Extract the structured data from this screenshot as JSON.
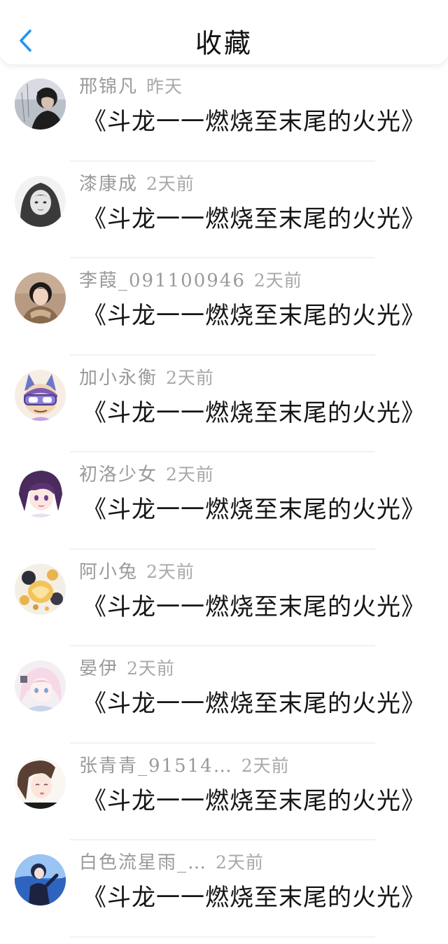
{
  "header": {
    "title": "收藏",
    "accent": "#2196f3"
  },
  "items": [
    {
      "name": "邢锦凡",
      "time": "昨天",
      "book": "《斗龙一一燃烧至末尾的火光》",
      "avatar": "avatar-dark-hair"
    },
    {
      "name": "漆康成",
      "time": "2天前",
      "book": "《斗龙一一燃烧至末尾的火光》",
      "avatar": "avatar-hooded-gray"
    },
    {
      "name": "李葭_091100946",
      "time": "2天前",
      "book": "《斗龙一一燃烧至末尾的火光》",
      "avatar": "avatar-girl-photo"
    },
    {
      "name": "加小永衡",
      "time": "2天前",
      "book": "《斗龙一一燃烧至末尾的火光》",
      "avatar": "avatar-cartoon-glasses"
    },
    {
      "name": "初洛少女",
      "time": "2天前",
      "book": "《斗龙一一燃烧至末尾的火光》",
      "avatar": "avatar-anime-purple"
    },
    {
      "name": "阿小兔",
      "time": "2天前",
      "book": "《斗龙一一燃烧至末尾的火光》",
      "avatar": "avatar-golden-illustration"
    },
    {
      "name": "晏伊",
      "time": "2天前",
      "book": "《斗龙一一燃烧至末尾的火光》",
      "avatar": "avatar-anime-pink"
    },
    {
      "name": "张青青_91514…",
      "time": "2天前",
      "book": "《斗龙一一燃烧至末尾的火光》",
      "avatar": "avatar-girl-illustration"
    },
    {
      "name": "白色流星雨_…",
      "time": "2天前",
      "book": "《斗龙一一燃烧至末尾的火光》",
      "avatar": "avatar-anime-blue"
    }
  ]
}
